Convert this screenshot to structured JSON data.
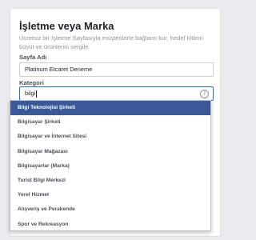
{
  "header": {
    "title": "İşletme veya Marka",
    "description": "Ücretsiz bir İşletme Sayfasıyla müşterilerle bağlantı kur, hedef kitleni büyüt ve ürünlerini sergile."
  },
  "form": {
    "page_name_label": "Sayfa Adı",
    "page_name_value": "Platinum Etcaret Deneme",
    "category_label": "Kategori",
    "category_value": "bilgi",
    "help_icon": "?"
  },
  "dropdown": {
    "options": [
      "Bilgi Teknolojisi Şirketi",
      "Bilgisayar Şirketi",
      "Bilgisayar ve İnternet Sitesi",
      "Bilgisayar Mağazası",
      "Bilgisayarlar (Marka)",
      "Turist Bilgi Merkezi",
      "Yerel Hizmet",
      "Alışveriş ve Perakende",
      "Spor ve Rekreasyon"
    ],
    "selected_index": 0
  },
  "colors": {
    "accent": "#3b5998",
    "background": "#e9ebee"
  }
}
